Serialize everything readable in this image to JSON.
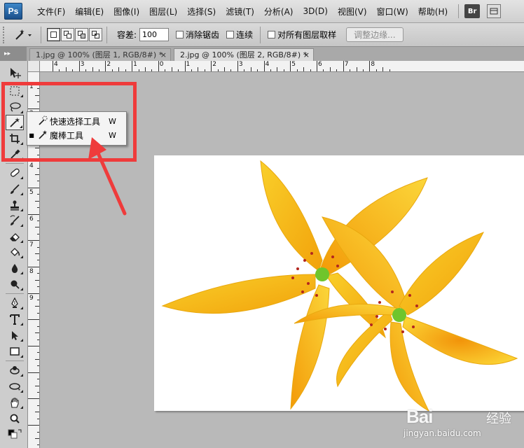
{
  "app": {
    "logo": "Ps",
    "menu": [
      "文件(F)",
      "编辑(E)",
      "图像(I)",
      "图层(L)",
      "选择(S)",
      "滤镜(T)",
      "分析(A)",
      "3D(D)",
      "视图(V)",
      "窗口(W)",
      "帮助(H)"
    ],
    "bridge_button": "Br"
  },
  "options": {
    "tolerance_label": "容差:",
    "tolerance_value": "100",
    "antialias_label": "消除锯齿",
    "contiguous_label": "连续",
    "sample_all_label": "对所有图层取样",
    "refine_edge_label": "调整边缘..."
  },
  "tabs": [
    {
      "label": "1.jpg @ 100% (图层 1, RGB/8#) *",
      "active": false
    },
    {
      "label": "2.jpg @ 100% (图层 2, RGB/8#) *",
      "active": true
    }
  ],
  "tab_close_glyph": "×",
  "panel_collapse_glyph": "▸▸",
  "rulers": {
    "horizontal_labels": [
      "4",
      "3",
      "2",
      "1",
      "0",
      "1",
      "2",
      "3",
      "4",
      "5",
      "6",
      "7",
      "8"
    ],
    "vertical_labels": [
      "1",
      "2",
      "3",
      "4",
      "5",
      "6",
      "7",
      "8",
      "9"
    ]
  },
  "flyout": {
    "items": [
      {
        "label": "快速选择工具",
        "shortcut": "W",
        "selected": false
      },
      {
        "label": "魔棒工具",
        "shortcut": "W",
        "selected": true
      }
    ]
  },
  "colors": {
    "annotation_red": "#ef3b3b",
    "petal_yellow": "#f7c21e",
    "petal_orange": "#f0a10a"
  },
  "watermark": {
    "brand": "Bai",
    "brand2": "经验",
    "url": "jingyan.baidu.com"
  }
}
